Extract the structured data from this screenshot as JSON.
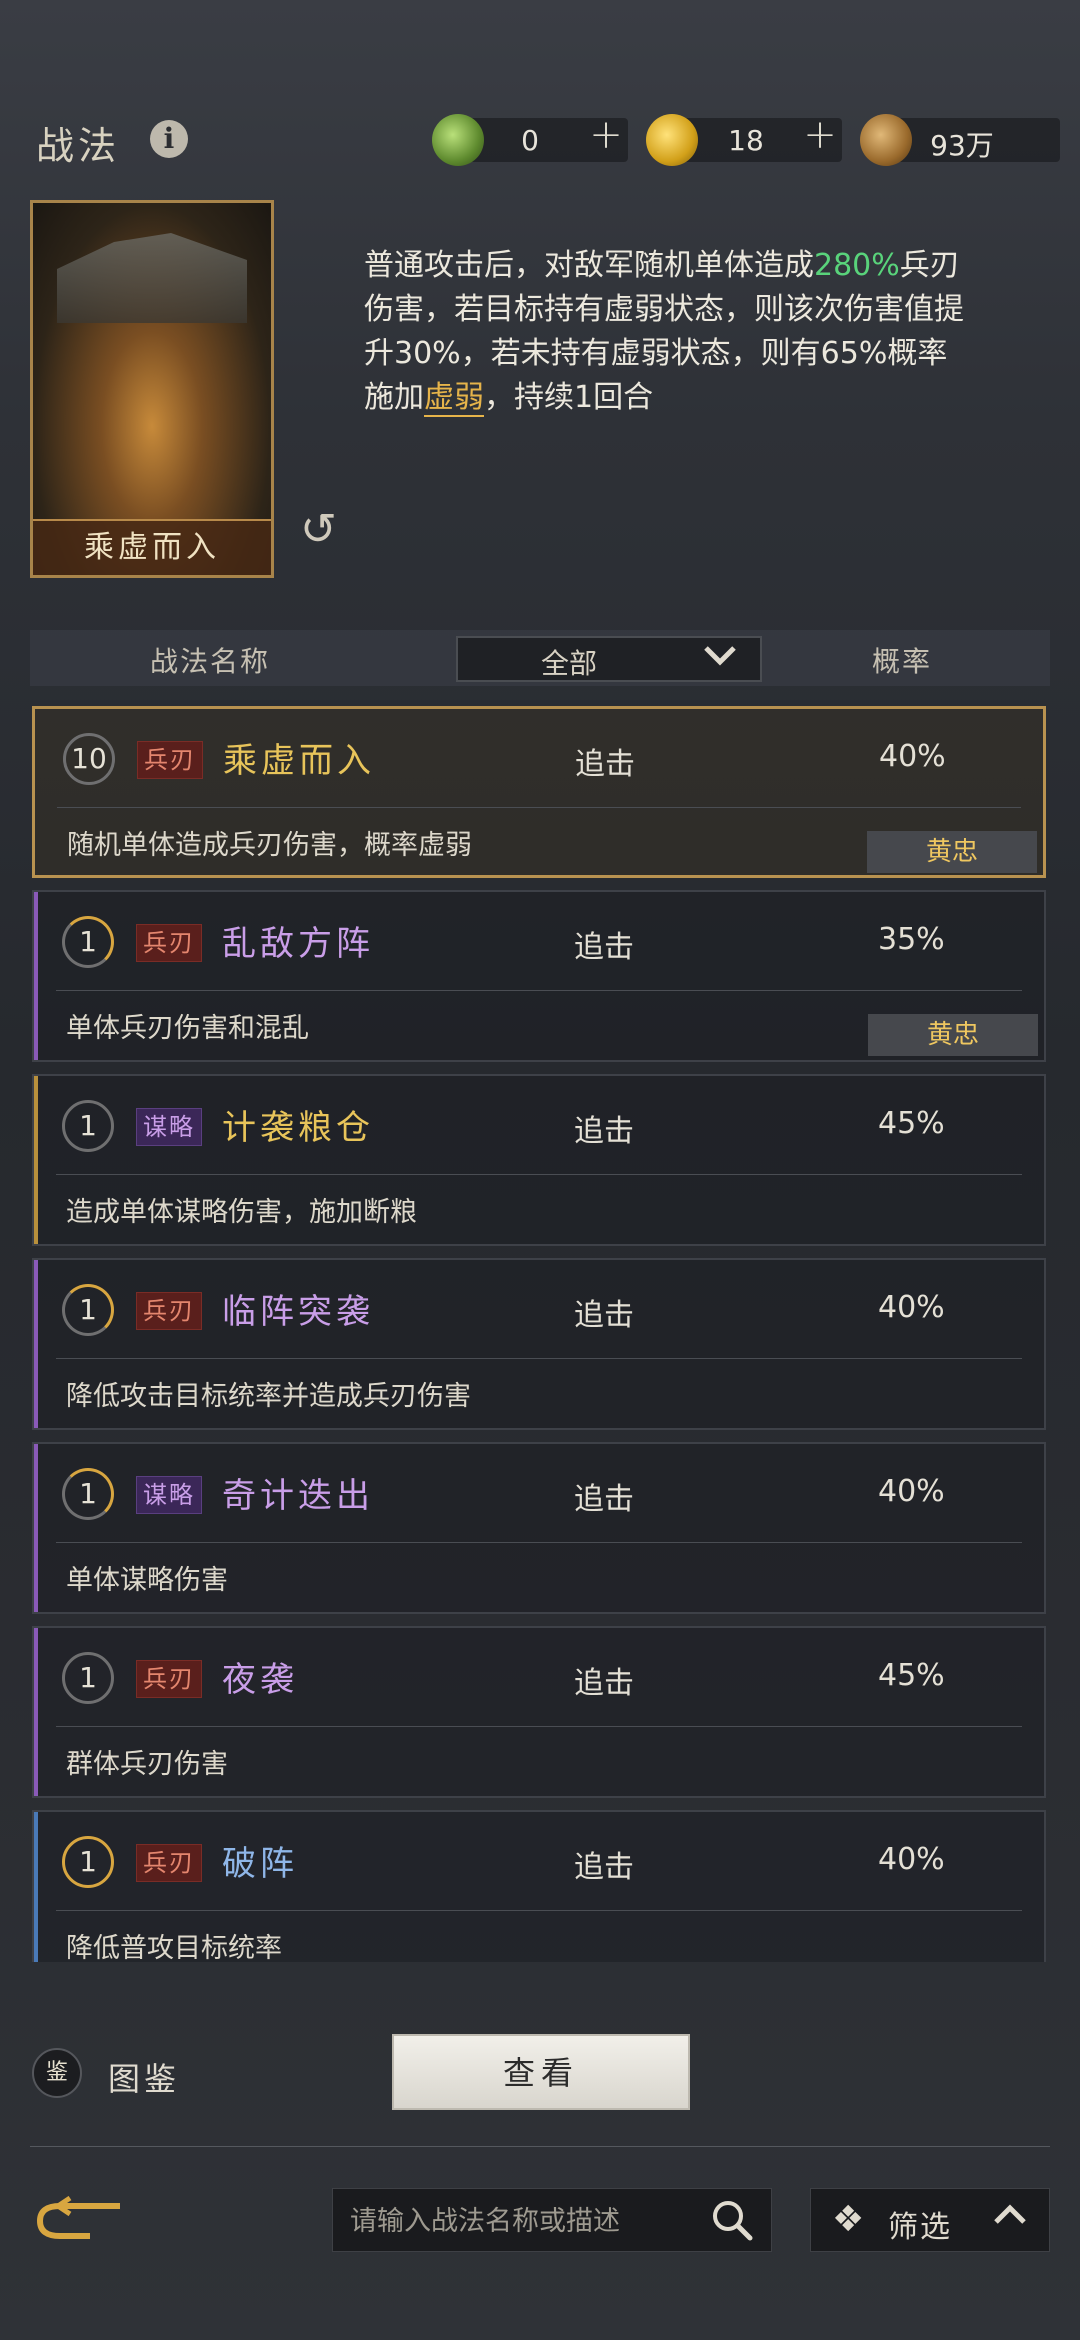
{
  "header": {
    "title": "战法",
    "currencies": [
      {
        "icon": "jade-coin-icon",
        "value": "0",
        "has_plus": true
      },
      {
        "icon": "gold-coin-icon",
        "value": "18",
        "has_plus": true
      },
      {
        "icon": "copper-coin-icon",
        "value": "93万",
        "has_plus": false
      }
    ]
  },
  "selected_skill": {
    "card_name": "乘虚而入",
    "desc_part1": "普通攻击后，对敌军随机单体造成",
    "desc_highlight": "280%",
    "desc_part2": "兵刃伤害，若目标持有虚弱状态，则该次伤害值提升30%，若未持有虚弱状态，则有65%概率施加",
    "desc_keyword": "虚弱",
    "desc_part3": "，持续1回合"
  },
  "table": {
    "col_name": "战法名称",
    "col_filter": "全部",
    "col_rate": "概率"
  },
  "skills": [
    {
      "level": "10",
      "tag": "兵刃",
      "name": "乘虚而入",
      "type": "追击",
      "rate": "40%",
      "desc": "随机单体造成兵刃伤害，概率虚弱",
      "owner": "黄忠"
    },
    {
      "level": "1",
      "tag": "兵刃",
      "name": "乱敌方阵",
      "type": "追击",
      "rate": "35%",
      "desc": "单体兵刃伤害和混乱",
      "owner": "黄忠"
    },
    {
      "level": "1",
      "tag": "谋略",
      "name": "计袭粮仓",
      "type": "追击",
      "rate": "45%",
      "desc": "造成单体谋略伤害，施加断粮",
      "owner": ""
    },
    {
      "level": "1",
      "tag": "兵刃",
      "name": "临阵突袭",
      "type": "追击",
      "rate": "40%",
      "desc": "降低攻击目标统率并造成兵刃伤害",
      "owner": ""
    },
    {
      "level": "1",
      "tag": "谋略",
      "name": "奇计迭出",
      "type": "追击",
      "rate": "40%",
      "desc": "单体谋略伤害",
      "owner": ""
    },
    {
      "level": "1",
      "tag": "兵刃",
      "name": "夜袭",
      "type": "追击",
      "rate": "45%",
      "desc": "群体兵刃伤害",
      "owner": ""
    },
    {
      "level": "1",
      "tag": "兵刃",
      "name": "破阵",
      "type": "追击",
      "rate": "40%",
      "desc": "降低普攻目标统率",
      "owner": ""
    }
  ],
  "bottom": {
    "tujian_icon_text": "鉴",
    "tujian_label": "图鉴",
    "view_button": "查看",
    "search_placeholder": "请输入战法名称或描述",
    "filter_label": "筛选"
  },
  "colors": {
    "gold_accent": "#d8a640",
    "highlight_green": "#59d37b",
    "purple_name": "#c99ee8",
    "gold_name": "#e8c45a",
    "blue_name": "#8fb6e8"
  }
}
